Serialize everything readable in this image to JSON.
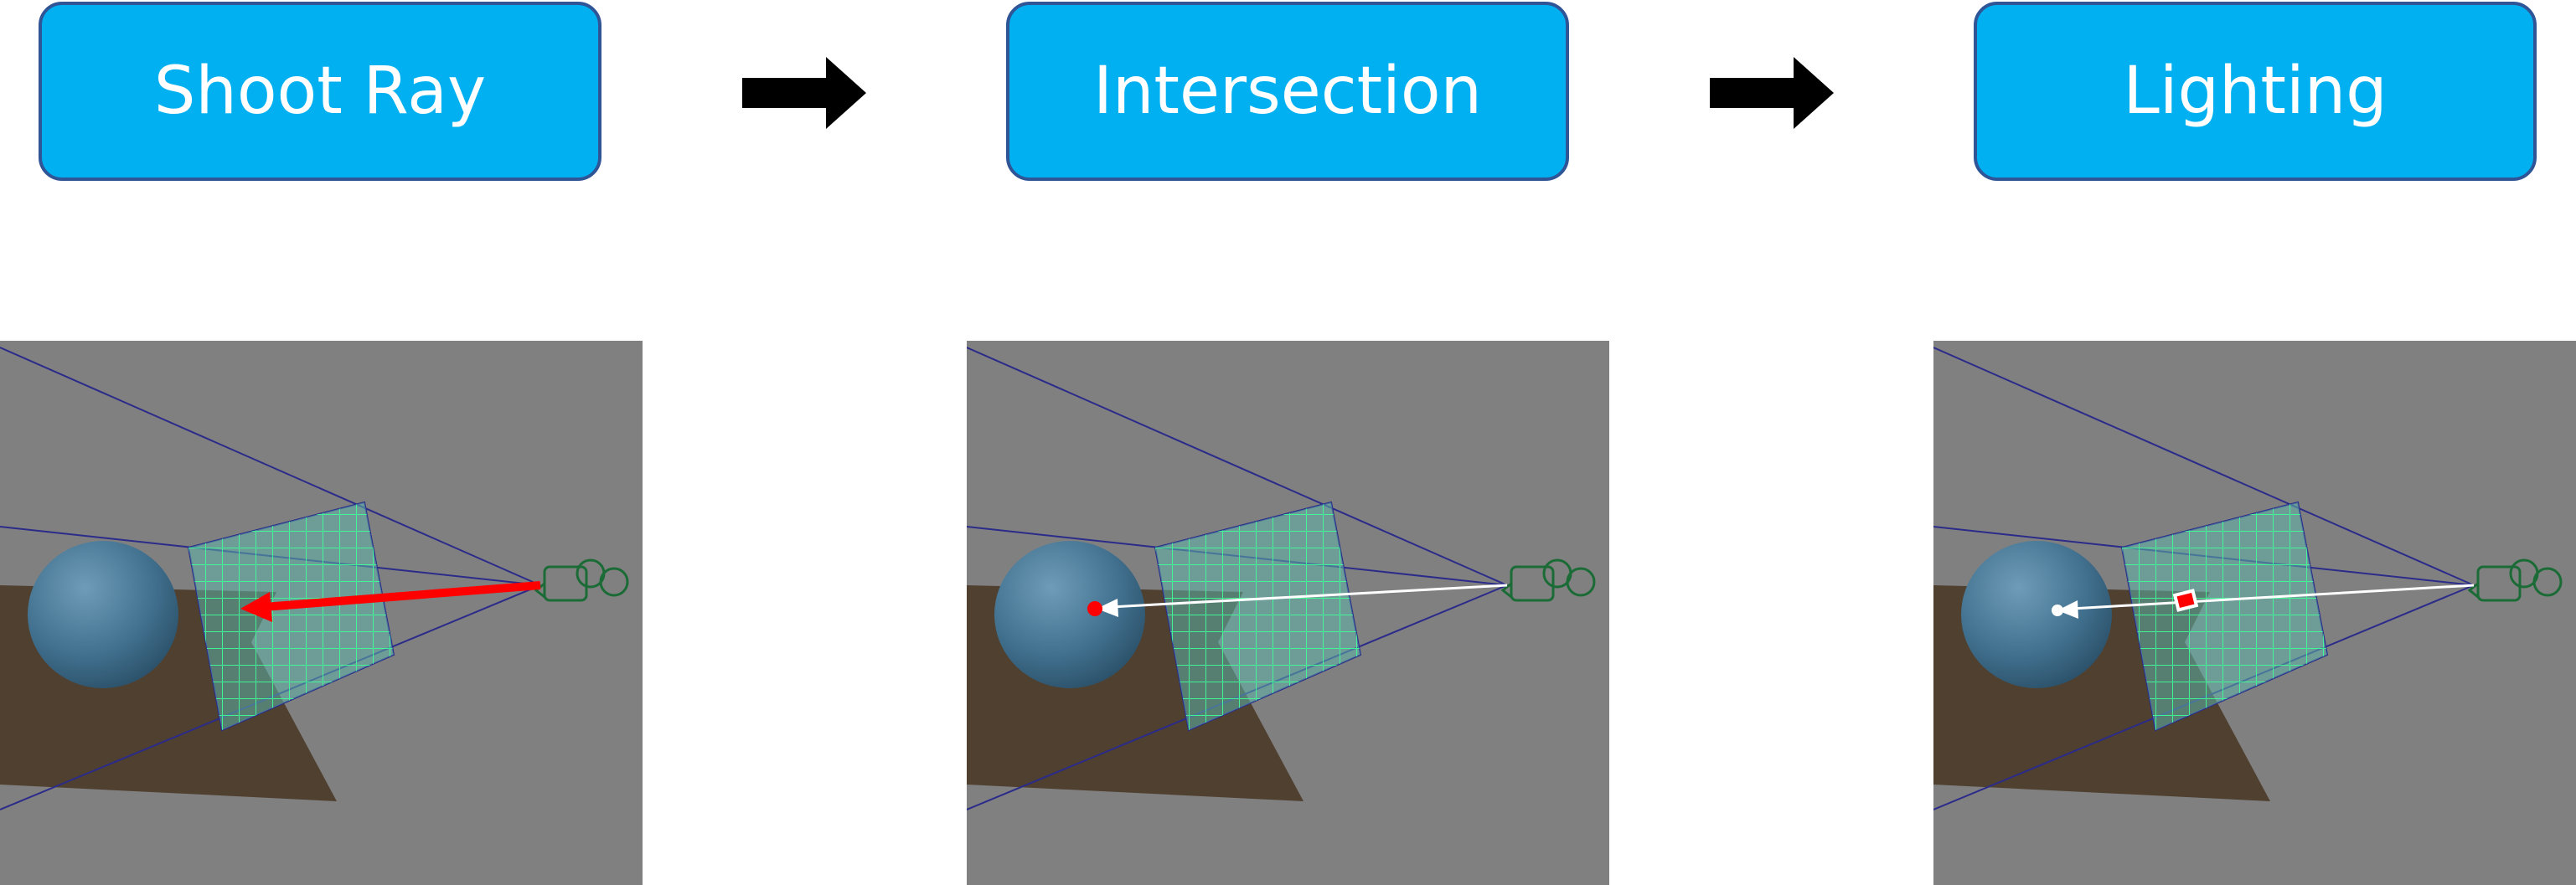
{
  "stages": [
    {
      "label": "Shoot Ray"
    },
    {
      "label": "Intersection"
    },
    {
      "label": "Lighting"
    }
  ],
  "colors": {
    "box_fill": "#00b0f0",
    "box_border": "#2f5597",
    "viewport_bg": "#808080",
    "floor": "#4f4030",
    "sphere": "#41718f",
    "frustum_line": "#2b2b8a",
    "grid_line": "#40ff9a",
    "camera": "#1a6b35",
    "ray_red": "#ff0000",
    "ray_white": "#ffffff"
  }
}
